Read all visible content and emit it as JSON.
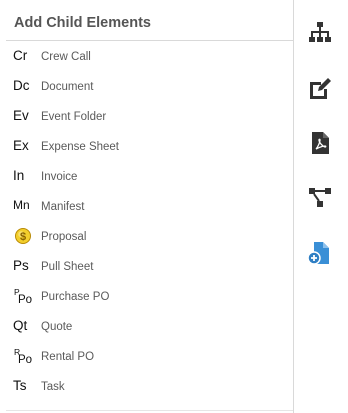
{
  "panel": {
    "title": "Add Child Elements",
    "items": [
      {
        "abbr": "Cr",
        "label": "Crew Call",
        "icon": "text-abbr"
      },
      {
        "abbr": "Dc",
        "label": "Document",
        "icon": "text-abbr"
      },
      {
        "abbr": "Ev",
        "label": "Event Folder",
        "icon": "text-abbr"
      },
      {
        "abbr": "Ex",
        "label": "Expense Sheet",
        "icon": "text-abbr"
      },
      {
        "abbr": "In",
        "label": "Invoice",
        "icon": "text-abbr"
      },
      {
        "abbr": "Mn",
        "label": "Manifest",
        "icon": "text-abbr"
      },
      {
        "abbr": "",
        "label": "Proposal",
        "icon": "dollar-coin-icon"
      },
      {
        "abbr": "Ps",
        "label": "Pull Sheet",
        "icon": "text-abbr"
      },
      {
        "abbr_sup": "P",
        "abbr_base": "Po",
        "label": "Purchase PO",
        "icon": "stacked-abbr"
      },
      {
        "abbr": "Qt",
        "label": "Quote",
        "icon": "text-abbr"
      },
      {
        "abbr_sup": "R",
        "abbr_base": "Po",
        "label": "Rental PO",
        "icon": "stacked-abbr"
      },
      {
        "abbr": "Ts",
        "label": "Task",
        "icon": "text-abbr"
      }
    ]
  },
  "toolbar": {
    "items": [
      {
        "icon": "hierarchy-icon",
        "color": "#333333"
      },
      {
        "icon": "edit-icon",
        "color": "#333333"
      },
      {
        "icon": "pdf-file-icon",
        "color": "#333333"
      },
      {
        "icon": "workflow-icon",
        "color": "#333333"
      },
      {
        "icon": "add-file-icon",
        "color": "#3a8fd6"
      }
    ]
  },
  "colors": {
    "title": "#555555",
    "label": "#5a5a5a",
    "accent_blue": "#3a8fd6",
    "coin": "#e8b90c"
  }
}
